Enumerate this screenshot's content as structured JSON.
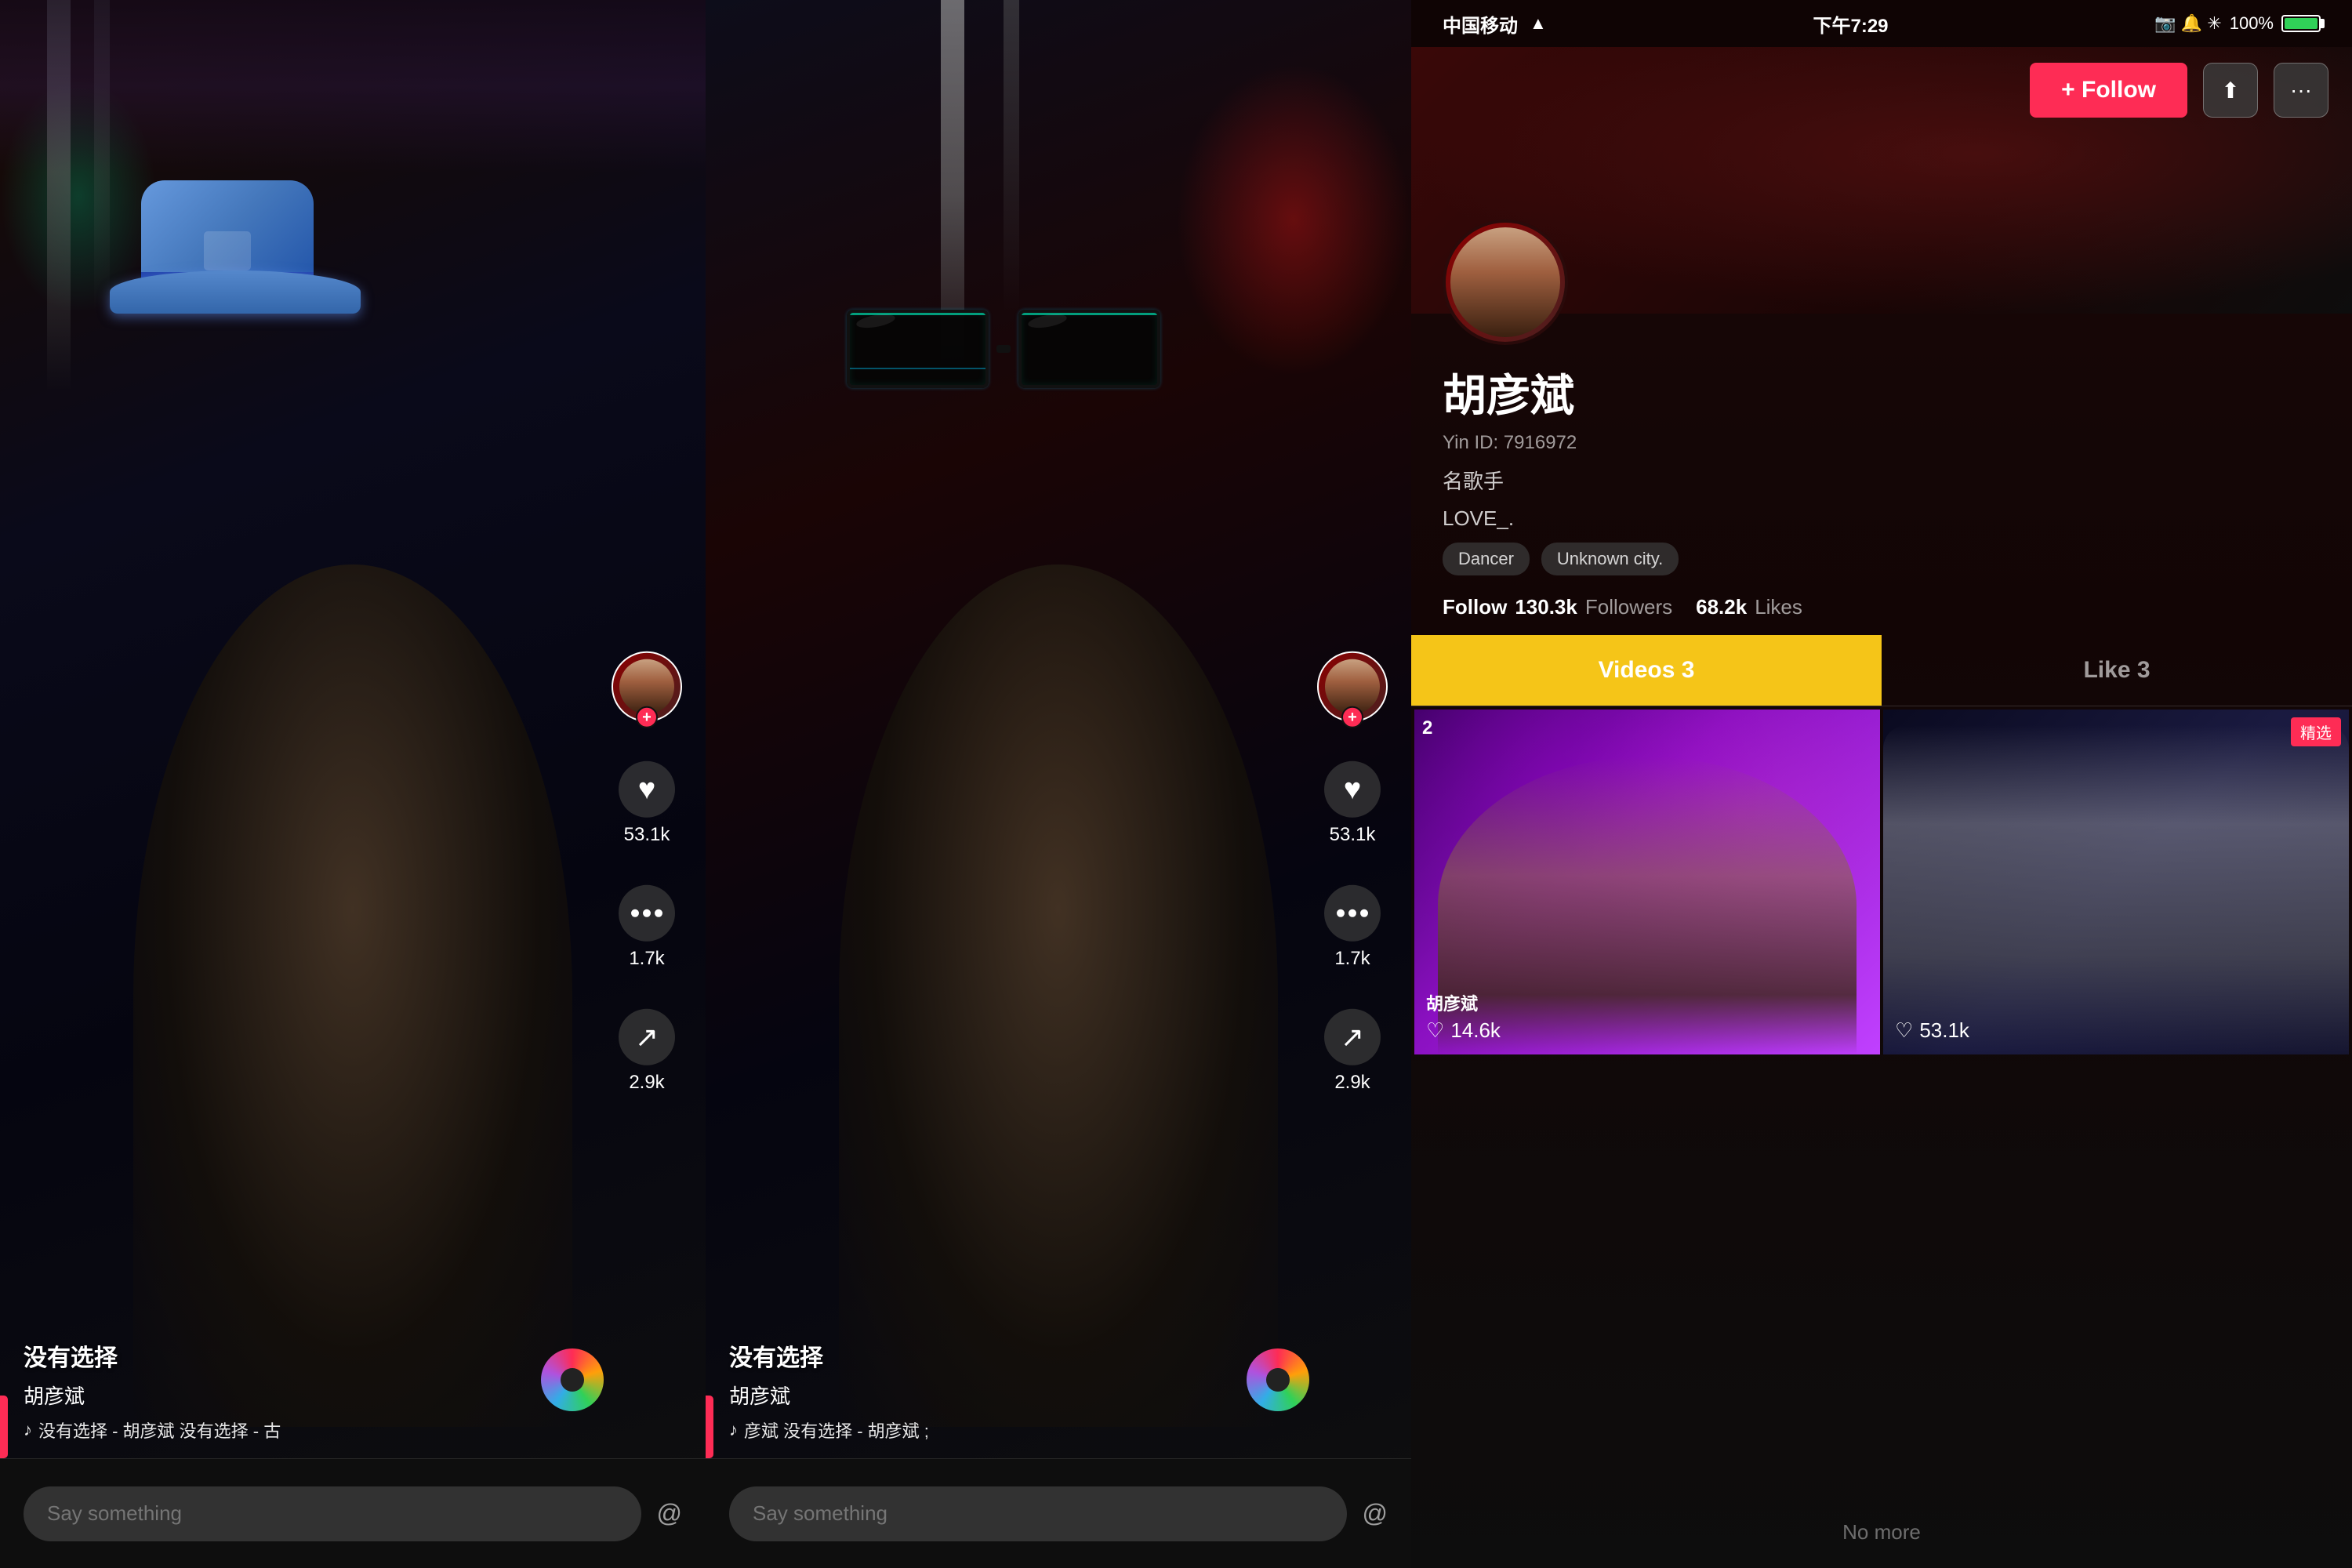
{
  "panels": {
    "panel1": {
      "title": "没有选择",
      "username": "胡彦斌",
      "song_text": "没有选择 - 胡彦斌 没有选择 - 古",
      "likes": "53.1k",
      "comments": "1.7k",
      "shares": "2.9k",
      "comment_placeholder": "Say something",
      "at_symbol": "@"
    },
    "panel2": {
      "title": "没有选择",
      "username": "胡彦斌",
      "song_text": "彦斌  没有选择 - 胡彦斌  ;",
      "likes": "53.1k",
      "comments": "1.7k",
      "shares": "2.9k",
      "comment_placeholder": "Say something",
      "at_symbol": "@"
    },
    "profile": {
      "status_bar": {
        "carrier": "中国移动",
        "wifi": "WiFi",
        "time": "下午7:29",
        "icons": "📷 🔔 ✳ 100%"
      },
      "follow_btn": "+ Follow",
      "name": "胡彦斌",
      "yin_id": "Yin ID: 7916972",
      "bio_line1": "名歌手",
      "bio_line2": "LOVE_.",
      "tags": [
        "Dancer",
        "Unknown city."
      ],
      "stats": {
        "follow_count": "Follow",
        "followers_num": "130.3k",
        "followers_label": "Followers",
        "likes_num": "68.2k",
        "likes_label": "Likes"
      },
      "tabs": [
        {
          "label": "Videos 3",
          "active": true
        },
        {
          "label": "Like 3",
          "active": false
        }
      ],
      "videos": [
        {
          "likes": "14.6k",
          "badge": ""
        },
        {
          "likes": "53.1k",
          "badge": "精选"
        }
      ],
      "no_more": "No more"
    }
  }
}
